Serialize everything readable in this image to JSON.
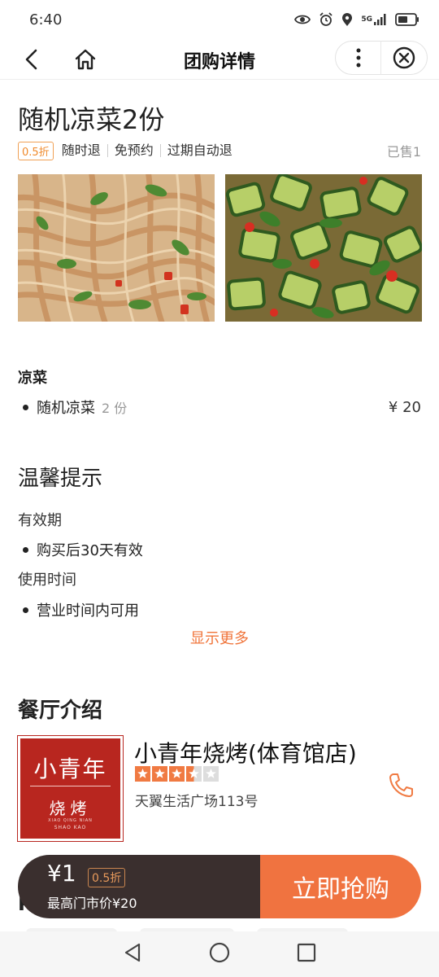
{
  "status_bar": {
    "time": "6:40",
    "network": "5G"
  },
  "nav": {
    "title": "团购详情"
  },
  "product": {
    "title": "随机凉菜2份",
    "discount_badge": "0.5折",
    "tags": [
      "随时退",
      "免预约",
      "过期自动退"
    ],
    "sold": "已售1"
  },
  "menu": {
    "category": "凉菜",
    "items": [
      {
        "name": "随机凉菜",
        "qty": "2 份",
        "price": "¥ 20"
      }
    ]
  },
  "tips": {
    "title": "温馨提示",
    "validity_label": "有效期",
    "validity_value": "购买后30天有效",
    "time_label": "使用时间",
    "time_value": "营业时间内可用",
    "show_more": "显示更多"
  },
  "restaurant": {
    "section_title": "餐厅介绍",
    "name": "小青年烧烤(体育馆店)",
    "rating": 3.5,
    "rating_max": 5,
    "address": "天翼生活广场113号",
    "logo_text_top": "小青年",
    "logo_text_bottom": "烧烤",
    "logo_pinyin_1": "XIAO QING NIAN",
    "logo_pinyin_2": "SHAO KAO"
  },
  "buy_bar": {
    "price": "¥1",
    "badge": "0.5折",
    "market_price": "最高门市价¥20",
    "button": "立即抢购"
  },
  "colors": {
    "accent": "#f07340",
    "dark": "#3a2f2e",
    "badge_orange": "#f08a2b",
    "star": "#f07a42"
  }
}
